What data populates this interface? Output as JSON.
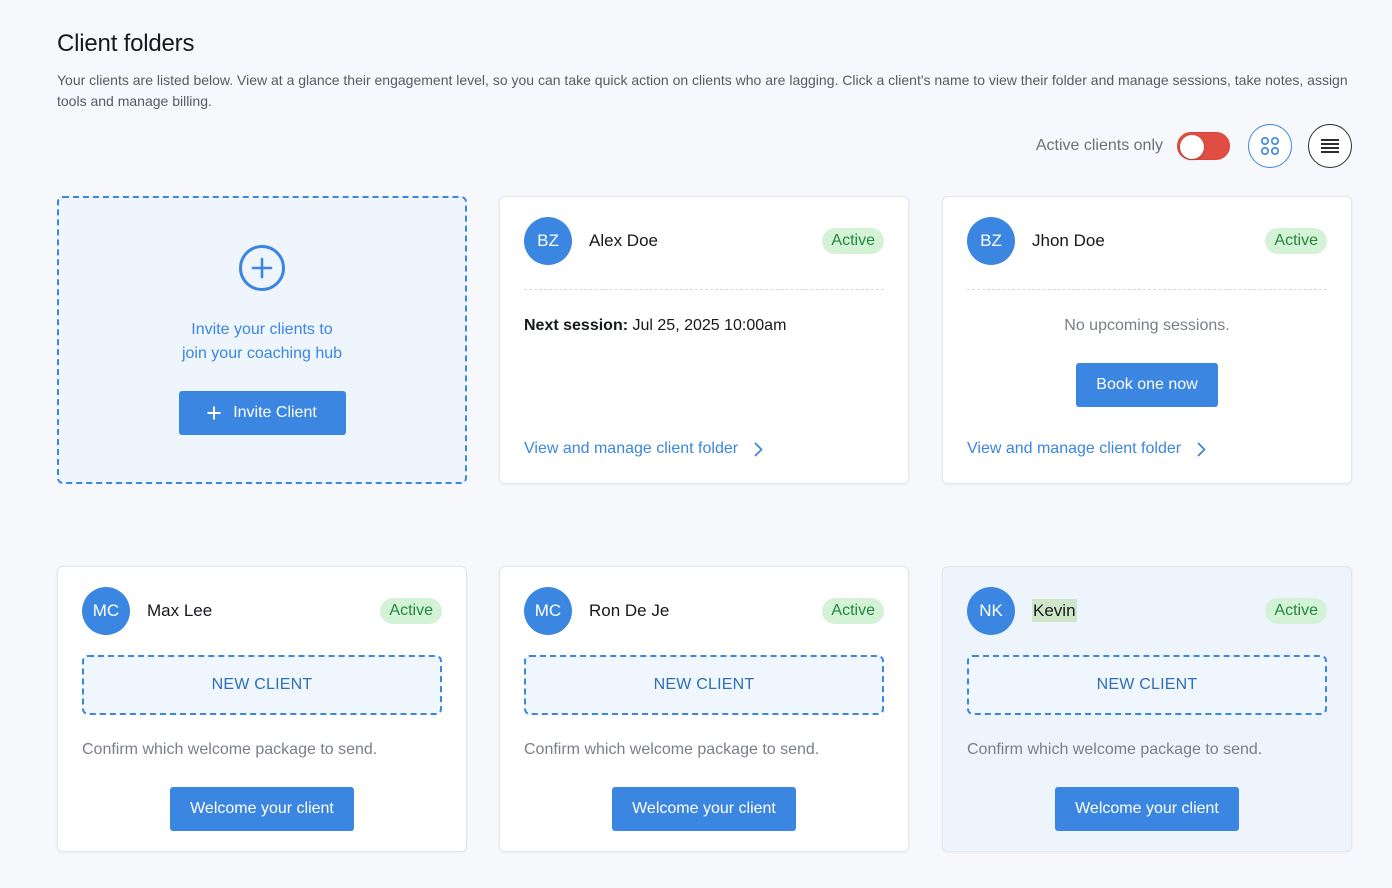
{
  "header": {
    "title": "Client folders",
    "description": "Your clients are listed below. View at a glance their engagement level, so you can take quick action on clients who are lagging. Click a client's name to view their folder and manage sessions, take notes, assign tools and manage billing."
  },
  "controls": {
    "active_only_label": "Active clients only",
    "active_only_on": false,
    "grid_view_icon": "grid-icon",
    "list_view_icon": "list-icon"
  },
  "invite": {
    "line1": "Invite your clients to",
    "line2": "join your coaching hub",
    "button_label": "Invite Client",
    "icon": "plus-circle-icon"
  },
  "clients": [
    {
      "initials": "BZ",
      "name": "Alex Doe",
      "status": "Active",
      "next_session_label": "Next session:",
      "next_session_value": "Jul 25, 2025 10:00am",
      "link_label": "View and manage client folder"
    },
    {
      "initials": "BZ",
      "name": "Jhon Doe",
      "status": "Active",
      "no_sessions_text": "No upcoming sessions.",
      "book_button_label": "Book one now",
      "link_label": "View and manage client folder"
    },
    {
      "initials": "MC",
      "name": "Max Lee",
      "status": "Active",
      "new_client_label": "NEW CLIENT",
      "confirm_text": "Confirm which welcome package to send.",
      "welcome_button_label": "Welcome your client"
    },
    {
      "initials": "MC",
      "name": "Ron De Je",
      "status": "Active",
      "new_client_label": "NEW CLIENT",
      "confirm_text": "Confirm which welcome package to send.",
      "welcome_button_label": "Welcome your client"
    },
    {
      "initials": "NK",
      "name": "Kevin",
      "status": "Active",
      "new_client_label": "NEW CLIENT",
      "confirm_text": "Confirm which welcome package to send.",
      "welcome_button_label": "Welcome your client"
    }
  ],
  "colors": {
    "accent": "#3b86e0",
    "toggle_off_red": "#e04e43",
    "active_badge_bg": "#d4f3d6",
    "active_badge_text": "#23873b"
  }
}
